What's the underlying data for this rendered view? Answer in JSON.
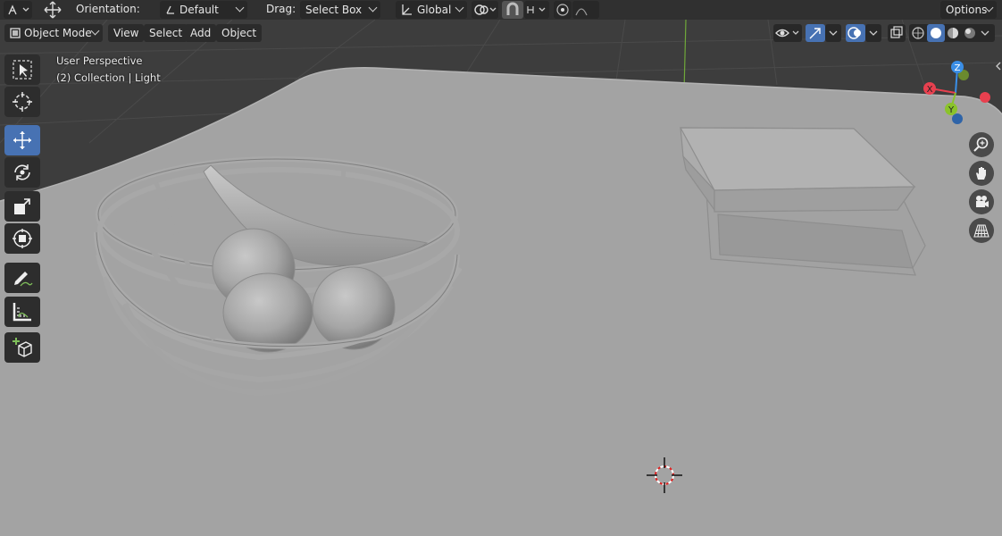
{
  "header": {
    "orientation_label": "Orientation:",
    "orientation_value": "Default",
    "drag_label": "Drag:",
    "drag_value": "Select Box",
    "transform_space": "Global",
    "options_label": "Options"
  },
  "mode_bar": {
    "mode": "Object Mode",
    "menus": [
      "View",
      "Select",
      "Add",
      "Object"
    ]
  },
  "viewport": {
    "perspective": "User Perspective",
    "collection": "(2) Collection | Light"
  },
  "gizmo": {
    "axes": [
      "Z",
      "X",
      "Y"
    ],
    "colors": {
      "x": "#e8404f",
      "y": "#8bc32b",
      "z": "#3a8ee6"
    }
  },
  "toolbar": {
    "tools": [
      "select-box-tool",
      "cursor-tool",
      "move-tool",
      "rotate-tool",
      "scale-tool",
      "transform-tool",
      "annotate-tool",
      "measure-tool",
      "add-cube-tool"
    ],
    "active_tool": "move-tool"
  },
  "theme": {
    "header_bg": "#303030",
    "accent": "#4772b3",
    "grid_bg": "#3d3d3d",
    "table_color": "#a3a3a3"
  }
}
